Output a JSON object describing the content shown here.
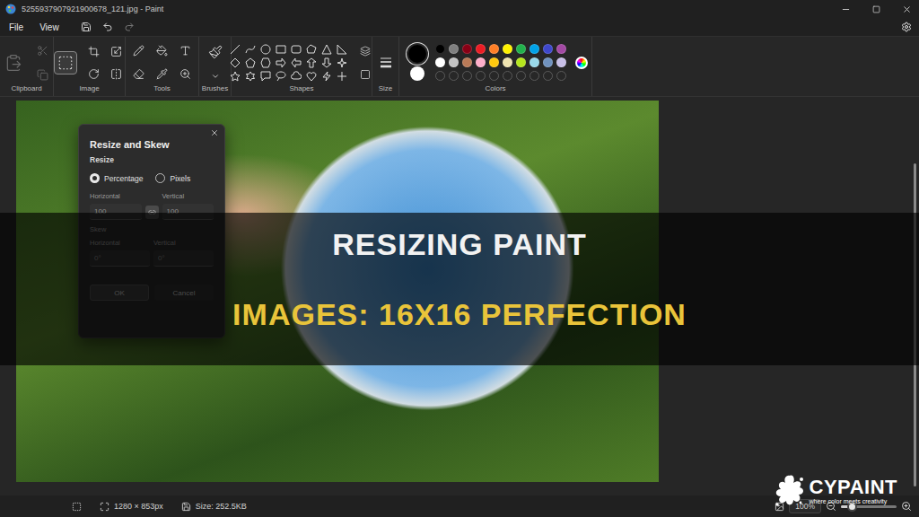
{
  "window": {
    "title": "5255937907921900678_121.jpg - Paint"
  },
  "menu": [
    "File",
    "View"
  ],
  "ribbon": {
    "groups": [
      "Clipboard",
      "Image",
      "Tools",
      "Brushes",
      "Shapes",
      "Size",
      "Colors"
    ],
    "clipboard_disabled": true,
    "selection_tool_active": true
  },
  "colors": {
    "primary": "#000000",
    "secondary": "#ffffff",
    "swatches": [
      {
        "color": "#000000"
      },
      {
        "color": "#7f7f7f"
      },
      {
        "color": "#880015"
      },
      {
        "color": "#ed1c24"
      },
      {
        "color": "#ff7f27"
      },
      {
        "color": "#fff200"
      },
      {
        "color": "#22b14c"
      },
      {
        "color": "#00a2e8"
      },
      {
        "color": "#3f48cc"
      },
      {
        "color": "#a349a4"
      },
      {
        "color": "#ffffff"
      },
      {
        "color": "#c3c3c3"
      },
      {
        "color": "#b97a57"
      },
      {
        "color": "#ffaec9"
      },
      {
        "color": "#ffc90e"
      },
      {
        "color": "#efe4b0"
      },
      {
        "color": "#b5e61d"
      },
      {
        "color": "#99d9ea"
      },
      {
        "color": "#7092be"
      },
      {
        "color": "#c8bfe7"
      }
    ],
    "empty_slots": 10
  },
  "dialog": {
    "title": "Resize and Skew",
    "resize_label": "Resize",
    "options": [
      {
        "label": "Percentage",
        "selected": true
      },
      {
        "label": "Pixels",
        "selected": false
      }
    ],
    "resize_fields": [
      {
        "label": "Horizontal",
        "value": "100"
      },
      {
        "label": "Vertical",
        "value": "100"
      }
    ],
    "aspect_locked": true,
    "skew_label": "Skew",
    "skew_fields": [
      {
        "label": "Horizontal",
        "value": "0°"
      },
      {
        "label": "Vertical",
        "value": "0°"
      }
    ],
    "buttons": [
      {
        "label": "OK",
        "primary": true
      },
      {
        "label": "Cancel",
        "primary": false
      }
    ]
  },
  "banner": {
    "lines": [
      "RESIZING PAINT",
      "IMAGES: 16X16 PERFECTION"
    ]
  },
  "logo": {
    "name": "CYPAINT",
    "tagline": "where color meets creativity"
  },
  "status_bar": {
    "dimensions": "1280 × 853px",
    "size": "Size: 252.5KB",
    "zoom": "100%",
    "zoom_level": 0.2
  }
}
